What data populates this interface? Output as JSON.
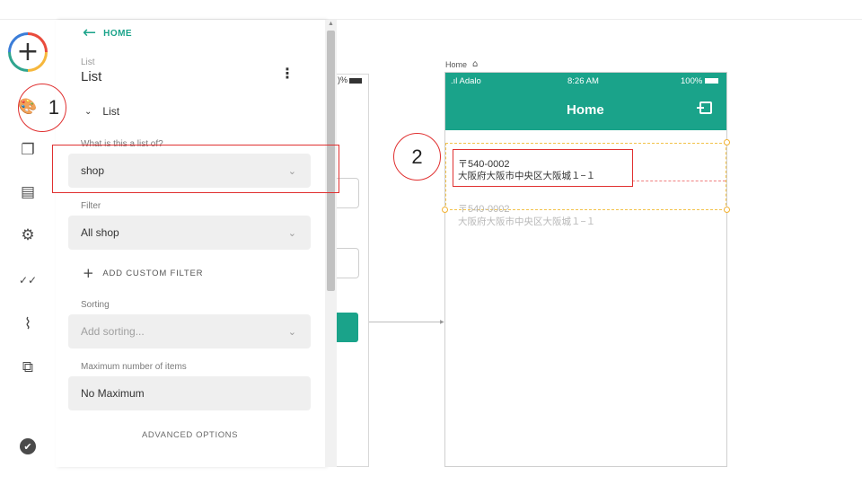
{
  "rail": {
    "add_icon": "plus-icon",
    "add_glyph": "+",
    "icons": [
      {
        "name": "palette-icon",
        "glyph": "🎨"
      },
      {
        "name": "screens-icon",
        "glyph": "❐"
      },
      {
        "name": "database-icon",
        "glyph": "▤"
      },
      {
        "name": "settings-icon",
        "glyph": "⚙"
      },
      {
        "name": "checkmarks-icon",
        "glyph": "✓✓"
      },
      {
        "name": "analytics-icon",
        "glyph": "⌇"
      },
      {
        "name": "publish-icon",
        "glyph": "⧉"
      }
    ],
    "verified_glyph": "✔"
  },
  "panel": {
    "back_arrow": "←",
    "back_label": "HOME",
    "component_type": "List",
    "component_name": "List",
    "kebab": "⋮",
    "section_chevron": "⌄",
    "section_label": "List",
    "list_of_label": "What is this a list of?",
    "list_of_value": "shop",
    "filter_label": "Filter",
    "filter_value": "All shop",
    "add_filter_plus": "+",
    "add_filter_label": "ADD CUSTOM FILTER",
    "sorting_label": "Sorting",
    "sorting_placeholder": "Add sorting...",
    "max_items_label": "Maximum number of items",
    "max_items_value": "No Maximum",
    "advanced_label": "ADVANCED OPTIONS",
    "select_chevron": "⌄"
  },
  "annotations": {
    "marker_1": "1",
    "marker_2": "2"
  },
  "mid_phone": {
    "status_percent": ")%"
  },
  "canvas": {
    "home_label": "Home",
    "home_icon": "⌂",
    "status_left": ".ıl Adalo",
    "status_time": "8:26 AM",
    "status_right": "100%",
    "screen_title": "Home",
    "items": [
      {
        "title": "〒540-0002",
        "subtitle": "大阪府大阪市中央区大阪城１−１"
      },
      {
        "title": "〒540-0002",
        "subtitle": "大阪府大阪市中央区大阪城１−１"
      }
    ]
  },
  "colors": {
    "accent": "#1aa38a",
    "annotation": "#e03030",
    "selection": "#f2c24a"
  }
}
